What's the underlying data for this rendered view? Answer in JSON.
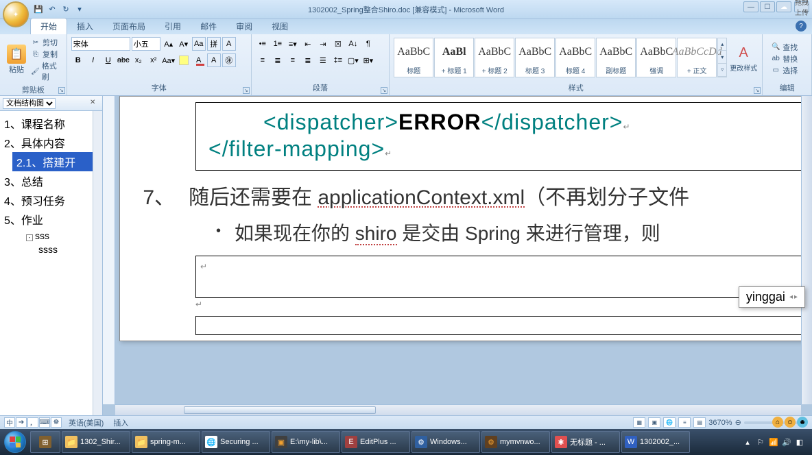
{
  "title": "1302002_Spring整合Shiro.doc [兼容模式] - Microsoft Word",
  "share_label": "拖拽上传",
  "tabs": [
    "开始",
    "插入",
    "页面布局",
    "引用",
    "邮件",
    "审阅",
    "视图"
  ],
  "ribbon": {
    "clipboard": {
      "label": "剪贴板",
      "paste": "粘贴",
      "cut": "剪切",
      "copy": "复制",
      "format": "格式刷"
    },
    "font": {
      "label": "字体",
      "name": "宋体",
      "size": "小五"
    },
    "para": {
      "label": "段落"
    },
    "styles": {
      "label": "样式",
      "items": [
        {
          "preview": "AaBbC",
          "name": "标题"
        },
        {
          "preview": "AaBl",
          "name": "+ 标题 1"
        },
        {
          "preview": "AaBbC",
          "name": "+ 标题 2"
        },
        {
          "preview": "AaBbC",
          "name": "标题 3"
        },
        {
          "preview": "AaBbC",
          "name": "标题 4"
        },
        {
          "preview": "AaBbC",
          "name": "副标题"
        },
        {
          "preview": "AaBbC",
          "name": "强调"
        },
        {
          "preview": "AaBbCcDd",
          "name": "+ 正文",
          "em": true
        }
      ],
      "change": "更改样式"
    },
    "edit": {
      "label": "编辑",
      "find": "查找",
      "replace": "替换",
      "select": "选择"
    }
  },
  "nav": {
    "header": "文档结构图",
    "items": [
      "1、课程名称",
      "2、具体内容",
      "2.1、搭建开",
      "3、总结",
      "4、预习任务",
      "5、作业",
      "sss",
      "ssss"
    ]
  },
  "doc": {
    "code1_a": "<dispatcher>",
    "code1_b": "ERROR",
    "code1_c": "</dispatcher>",
    "code2": "</filter-mapping>",
    "list_num": "7、",
    "list_text_a": "随后还需要在 ",
    "list_link": "applicationContext.xml",
    "list_text_b": "（不再划分子文件",
    "bullet_a": "如果现在你的 ",
    "bullet_u1": "shiro",
    "bullet_b": " 是交由 Spring 来进行管理，则",
    "ime": "yinggai"
  },
  "status": {
    "lang": "英语(美国)",
    "mode": "插入",
    "zoom": "3670%"
  },
  "taskbar": {
    "items": [
      {
        "icon": "📁",
        "label": "1302_Shir..."
      },
      {
        "icon": "📁",
        "label": "spring-m..."
      },
      {
        "icon": "🌐",
        "label": "Securing ..."
      },
      {
        "icon": "▣",
        "label": "E:\\my-lib\\..."
      },
      {
        "icon": "E",
        "label": "EditPlus ..."
      },
      {
        "icon": "⚙",
        "label": "Windows..."
      },
      {
        "icon": "⚙",
        "label": "mymvnwo..."
      },
      {
        "icon": "✱",
        "label": "无标题 - ..."
      },
      {
        "icon": "W",
        "label": "1302002_..."
      }
    ],
    "time": "",
    "date": ""
  }
}
